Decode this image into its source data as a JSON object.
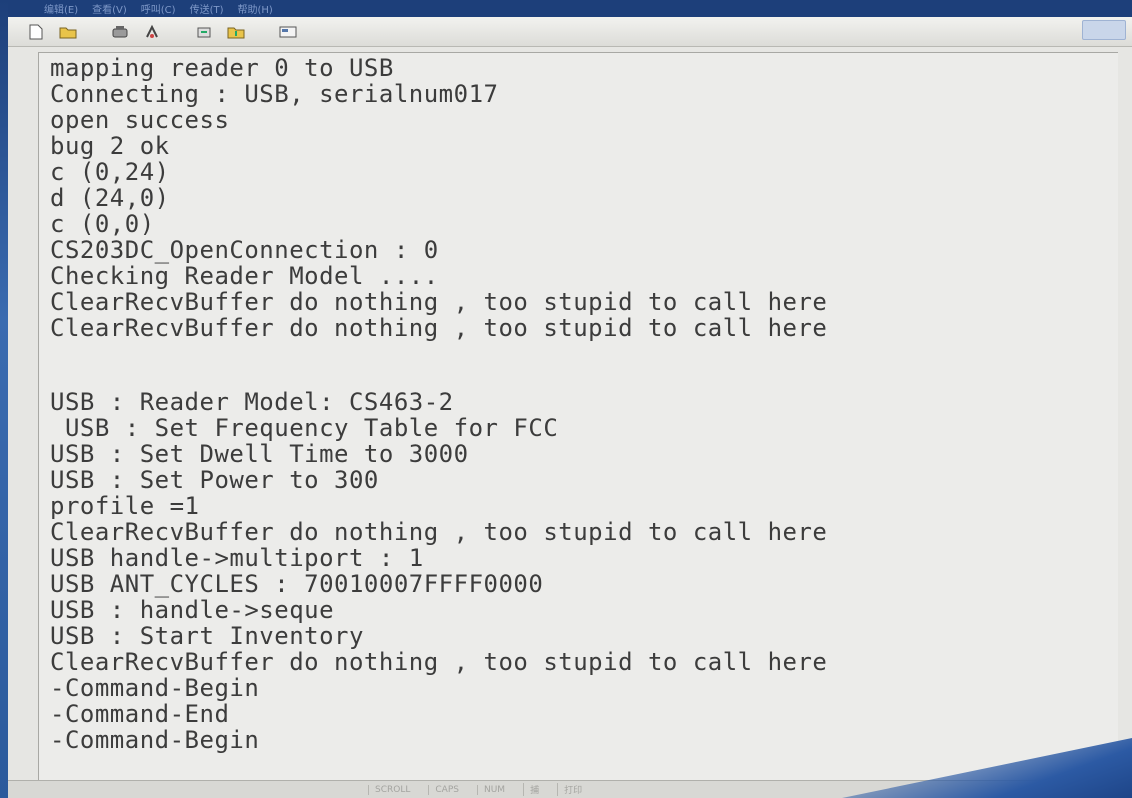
{
  "menu": {
    "items": [
      "编辑(E)",
      "查看(V)",
      "呼叫(C)",
      "传送(T)",
      "帮助(H)"
    ]
  },
  "toolbar": {
    "icons": [
      "new-icon",
      "open-icon",
      "phone-icon",
      "hangup-icon",
      "send-icon",
      "receive-icon",
      "properties-icon"
    ]
  },
  "terminal": {
    "lines": [
      "mapping reader 0 to USB",
      "Connecting : USB, serialnum017",
      "open success",
      "bug 2 ok",
      "c (0,24)",
      "d (24,0)",
      "c (0,0)",
      "CS203DC_OpenConnection : 0",
      "Checking Reader Model ....",
      "ClearRecvBuffer do nothing , too stupid to call here",
      "ClearRecvBuffer do nothing , too stupid to call here",
      "",
      "USB : Reader Model: CS463-2",
      " USB : Set Frequency Table for FCC",
      "USB : Set Dwell Time to 3000",
      "USB : Set Power to 300",
      "profile =1",
      "ClearRecvBuffer do nothing , too stupid to call here",
      "USB handle->multiport : 1",
      "USB ANT_CYCLES : 70010007FFFF0000",
      "USB : handle->seque",
      "USB : Start Inventory",
      "ClearRecvBuffer do nothing , too stupid to call here",
      "-Command-Begin",
      "-Command-End",
      "-Command-Begin"
    ]
  },
  "statusbar": {
    "cells": [
      "SCROLL",
      "CAPS",
      "NUM",
      "捕",
      "打印"
    ]
  },
  "colors": {
    "terminal_bg": "#ececea",
    "terminal_text": "#3c3c3c",
    "title_bar": "#1d3f7a"
  }
}
